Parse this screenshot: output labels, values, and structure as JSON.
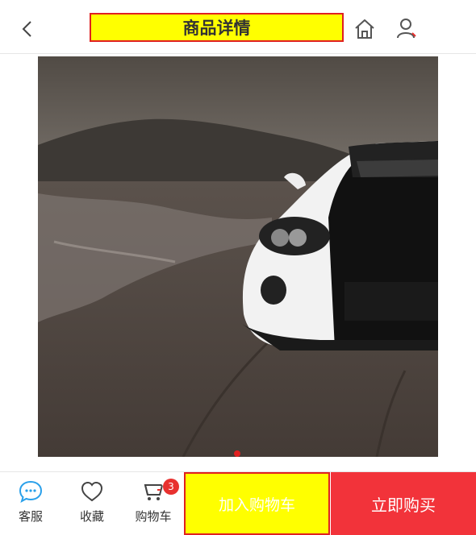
{
  "header": {
    "title": "商品详情",
    "back_icon": "chevron-left-icon",
    "home_icon": "home-icon",
    "user_icon": "user-icon"
  },
  "gallery": {
    "current_index": 0,
    "total": 1
  },
  "bottom": {
    "service_label": "客服",
    "favorite_label": "收藏",
    "cart_label": "购物车",
    "cart_count": "3",
    "add_to_cart_label": "加入购物车",
    "buy_now_label": "立即购买"
  },
  "colors": {
    "accent": "#f2333a",
    "highlight": "#ffff00",
    "icon_blue": "#2aa0ea"
  }
}
